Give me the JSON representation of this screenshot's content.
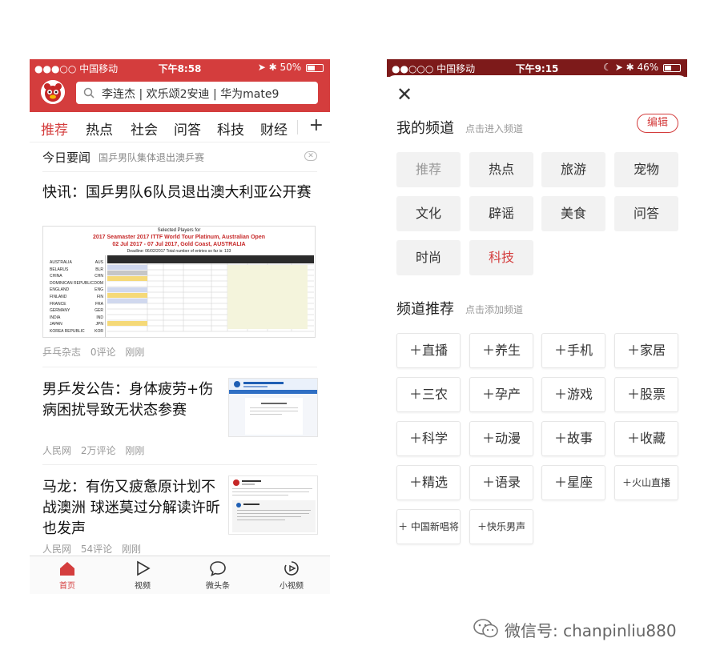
{
  "left": {
    "status": {
      "carrier": "●●●○○ 中国移动",
      "time": "下午8:58",
      "battery": "50%",
      "battery_level": 0.5
    },
    "search_placeholder": "李连杰 | 欢乐颂2安迪 | 华为mate9",
    "tabs": [
      "推荐",
      "热点",
      "社会",
      "问答",
      "科技",
      "财经"
    ],
    "tab_plus": "+",
    "today": {
      "label": "今日要闻",
      "headline": "国乒男队集体退出澳乒赛",
      "close": "✕"
    },
    "articles": [
      {
        "title": "快讯：国乒男队6队员退出澳大利亚公开赛",
        "image_header": "Selected Players for",
        "image_title1": "2017 Seamaster 2017 ITTF World Tour Platinum, Australian Open",
        "image_title2": "02 Jul 2017 - 07 Jul 2017, Gold Coast, AUSTRALIA",
        "image_deadline": "Deadline: 06/02/2017     Total number of entries so far is: 133",
        "countries": [
          "AUSTRALIA",
          "BELARUS",
          "CHINA",
          "DOMINICAN REPUBLIC",
          "ENGLAND",
          "FINLAND",
          "FRANCE",
          "GERMANY",
          "INDIA",
          "JAPAN",
          "KOREA REPUBLIC"
        ],
        "country_codes": [
          "AUS",
          "BLR",
          "CHN",
          "DOM",
          "ENG",
          "FIN",
          "FRA",
          "GER",
          "IND",
          "JPN",
          "KOR"
        ],
        "source": "乒乓杂志",
        "comments": "0评论",
        "time": "刚刚"
      },
      {
        "title": "男乒发公告：身体疲劳+伤病困扰导致无状态参赛",
        "source": "人民网",
        "comments": "2万评论",
        "time": "刚刚"
      },
      {
        "title": "马龙：有伤又疲惫原计划不战澳洲 球迷莫过分解读许昕也发声",
        "source": "人民网",
        "comments": "54评论",
        "time": "刚刚"
      }
    ],
    "nav": [
      {
        "label": "首页"
      },
      {
        "label": "视频"
      },
      {
        "label": "微头条"
      },
      {
        "label": "小视频"
      }
    ]
  },
  "right": {
    "status": {
      "carrier": "●●○○○ 中国移动",
      "time": "下午9:15",
      "battery": "46%",
      "battery_level": 0.46
    },
    "close": "✕",
    "my_channels": {
      "title": "我的频道",
      "hint": "点击进入频道",
      "edit": "编辑"
    },
    "my_channel_items": [
      "推荐",
      "热点",
      "旅游",
      "宠物",
      "文化",
      "辟谣",
      "美食",
      "问答",
      "时尚",
      "科技"
    ],
    "recommend": {
      "title": "频道推荐",
      "hint": "点击添加频道"
    },
    "recommend_items": [
      "＋直播",
      "＋养生",
      "＋手机",
      "＋家居",
      "＋三农",
      "＋孕产",
      "＋游戏",
      "＋股票",
      "＋科学",
      "＋动漫",
      "＋故事",
      "＋收藏",
      "＋精选",
      "＋语录",
      "＋星座",
      "＋火山直播",
      "＋ 中国新唱将",
      "＋快乐男声"
    ]
  },
  "watermark": "微信号: chanpinliu880",
  "colors": {
    "brand_red": "#d43d3d",
    "dark_red": "#7d1a1a",
    "gray_text": "#999999"
  }
}
